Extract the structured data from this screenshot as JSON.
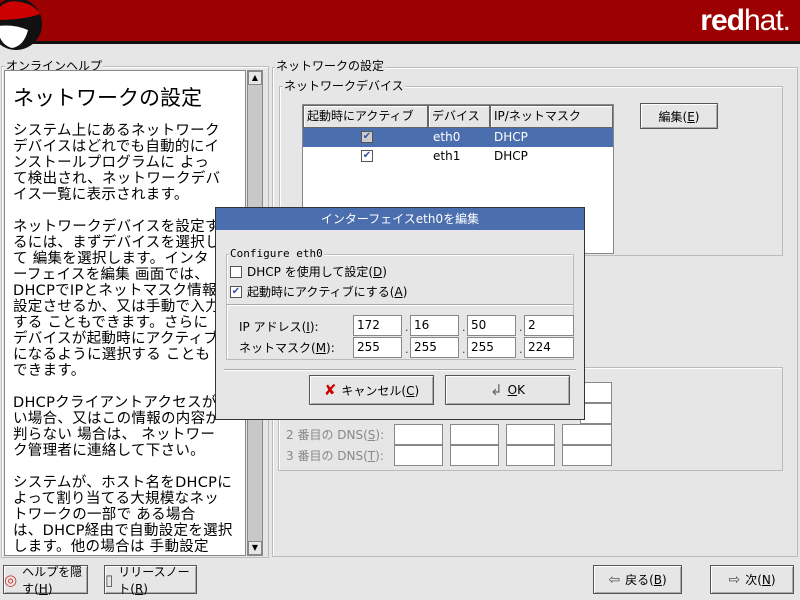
{
  "header": {
    "brand_bold": "red",
    "brand_light": "hat."
  },
  "help": {
    "frame_label": "オンラインヘルプ",
    "title": "ネットワークの設定",
    "paragraphs": [
      "システム上にあるネットワーク\nデバイスはどれでも自動的にイ\nンストールプログラムに よっ\nて検出され、ネットワークデバ\nイス一覧に表示されます。",
      "ネットワークデバイスを設定す\nるには、まずデバイスを選択し\nて 編集を選択します。インタ\nーフェイスを編集 画面では、\nDHCPでIPとネットマスク情報を\n設定させるか、又は手動で入力\nする こともできます。さらに\nデバイスが起動時にアクティブ\nになるように選択する ことも\nできます。",
      "DHCPクライアントアクセスがな\nい場合、又はこの情報の内容が\n判らない 場合は、 ネットワー\nク管理者に連絡して下さい。",
      "システムが、ホスト名をDHCPに\nよって割り当てる大規模なネッ\nトワークの一部で ある場合\nは、DHCP経由で自動設定を選択\nします。他の場合は 手動設定"
    ]
  },
  "main": {
    "frame_label": "ネットワークの設定",
    "devices_label": "ネットワークデバイス",
    "columns": [
      "起動時にアクティブ",
      "デバイス",
      "IP/ネットマスク"
    ],
    "rows": [
      {
        "active": true,
        "device": "eth0",
        "ip": "DHCP",
        "selected": true
      },
      {
        "active": true,
        "device": "eth1",
        "ip": "DHCP",
        "selected": false
      }
    ],
    "edit_button": "編集(",
    "edit_key": "E",
    "dns2_label": "2 番目の DNS(",
    "dns2_key": "S",
    "dns3_label": "3 番目の DNS(",
    "dns3_key": "T",
    "label_suffix": "):"
  },
  "dialog": {
    "title": "インターフェイスeth0を編集",
    "group_label": "Configure eth0",
    "dhcp_label": "DHCP を使用して設定(",
    "dhcp_key": "D",
    "dhcp_checked": false,
    "onboot_label": "起動時にアクティブにする(",
    "onboot_key": "A",
    "onboot_checked": true,
    "ip_label": "IP アドレス(",
    "ip_key": "I",
    "mask_label": "ネットマスク(",
    "mask_key": "M",
    "close_paren": "):",
    "ip": [
      "172",
      "16",
      "50",
      "2"
    ],
    "mask": [
      "255",
      "255",
      "255",
      "224"
    ],
    "cancel": "キャンセル(",
    "cancel_key": "C",
    "ok_key": "O",
    "ok_rest": "K"
  },
  "footer": {
    "hide_help": "ヘルプを隠す(",
    "hide_help_key": "H",
    "release_notes": "リリースノート(",
    "release_notes_key": "R",
    "back": "戻る(",
    "back_key": "B",
    "next": "次(",
    "next_key": "N",
    "paren": ")"
  }
}
